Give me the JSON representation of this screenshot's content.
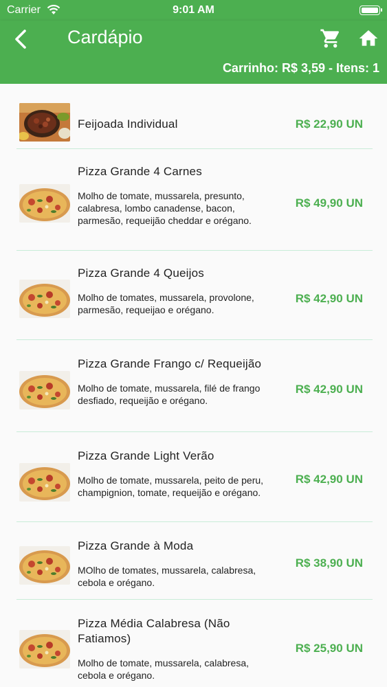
{
  "status_bar": {
    "carrier": "Carrier",
    "time": "9:01 AM"
  },
  "app_bar": {
    "title": "Cardápio",
    "cart_summary": "Carrinho: R$ 3,59 - Itens: 1",
    "icons": [
      "back-arrow-icon",
      "shopping-cart-icon",
      "home-icon"
    ]
  },
  "colors": {
    "primary": "#4caf50",
    "price": "#4caf50",
    "divider": "#c8ecd8"
  },
  "menu": {
    "items": [
      {
        "name": "Feijoada Individual",
        "description": "",
        "price": "R$ 22,90 UN",
        "image": "feijoada"
      },
      {
        "name": "Pizza Grande 4 Carnes",
        "description": "Molho de tomate, mussarela, presunto, calabresa, lombo canadense, bacon, parmesão, requeijão cheddar e orégano.",
        "price": "R$ 49,90 UN",
        "image": "pizza"
      },
      {
        "name": "Pizza Grande 4 Queijos",
        "description": "Molho de tomates, mussarela, provolone, parmesão, requeijao e orégano.",
        "price": "R$ 42,90 UN",
        "image": "pizza"
      },
      {
        "name": "Pizza Grande Frango c/ Requeijão",
        "description": "Molho de tomate, mussarela, filé de frango desfiado, requeijão e orégano.",
        "price": "R$ 42,90 UN",
        "image": "pizza"
      },
      {
        "name": "Pizza Grande Light Verão",
        "description": "Molho de tomate, mussarela, peito de peru, champignion, tomate, requeijão e orégano.",
        "price": "R$ 42,90 UN",
        "image": "pizza"
      },
      {
        "name": "Pizza Grande à Moda",
        "description": "MOlho de tomates, mussarela, calabresa, cebola e orégano.",
        "price": "R$ 38,90 UN",
        "image": "pizza"
      },
      {
        "name": "Pizza Média Calabresa (Não Fatiamos)",
        "description": "Molho de tomate, mussarela, calabresa, cebola e orégano.",
        "price": "R$ 25,90 UN",
        "image": "pizza"
      }
    ]
  }
}
